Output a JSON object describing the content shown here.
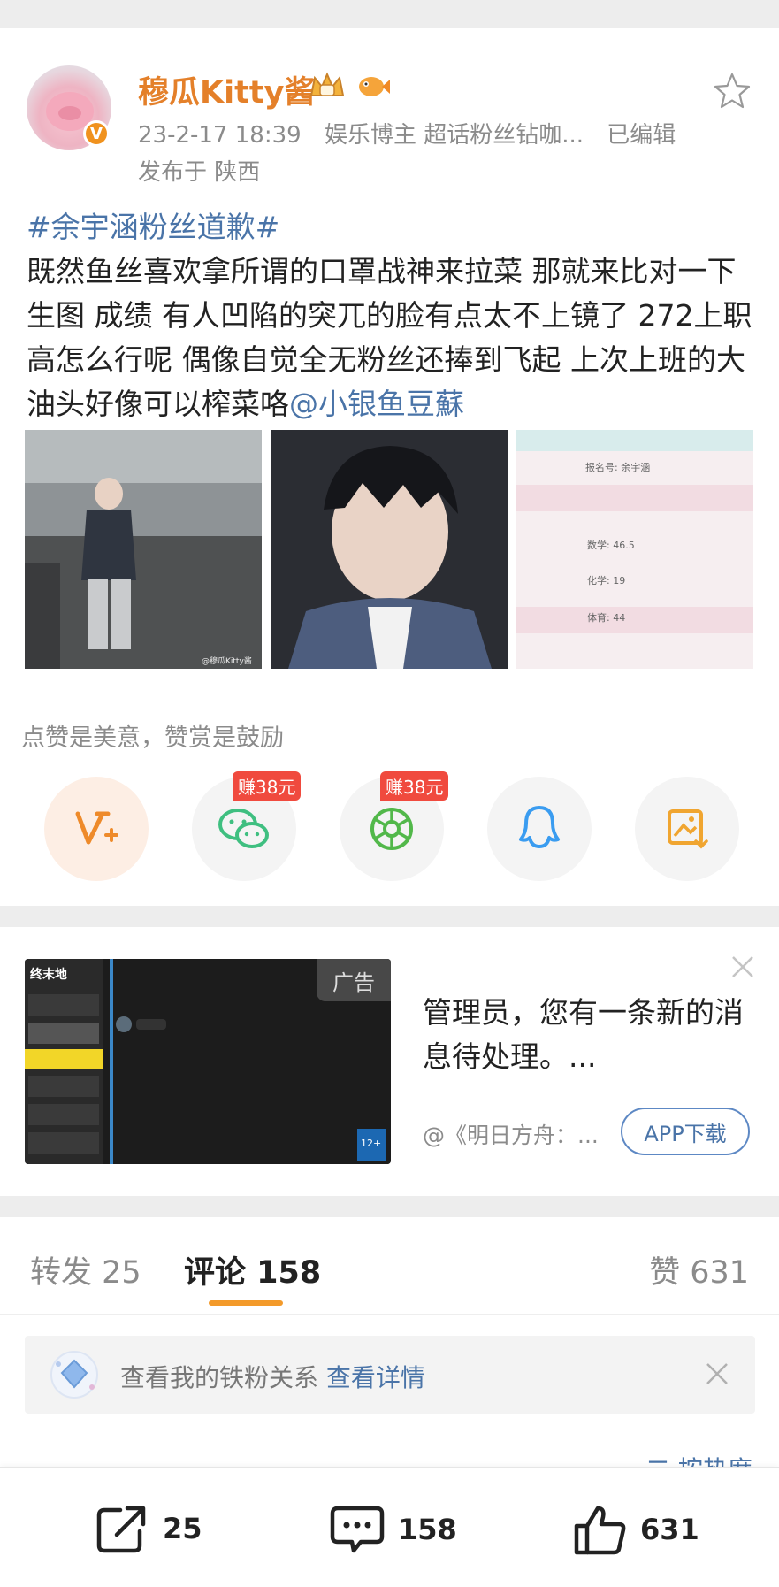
{
  "post": {
    "author": "穆瓜Kitty酱",
    "timestamp": "23-2-17 18:39",
    "author_tag": "娱乐博主 超话粉丝钻咖...",
    "edited": "已编辑",
    "location": "发布于 陕西",
    "topic": "#余宇涵粉丝道歉#",
    "body": "既然鱼丝喜欢拿所谓的口罩战神来拉菜 那就来比对一下生图 成绩 有人凹陷的突兀的脸有点太不上镜了 272上职高怎么行呢 偶像自觉全无粉丝还捧到飞起 上次上班的大油头好像可以榨菜咯",
    "mention": "@小银鱼豆蘇",
    "verified_badge": "V",
    "icons": [
      "crown-badge-icon",
      "fish-badge-icon",
      "star-icon"
    ]
  },
  "images": {
    "watermark": "@穆瓜Kitty酱",
    "score_sheet": {
      "name_row": "报名号: 余宇涵",
      "rows": [
        "数学: 46.5",
        "化学: 19",
        "体育: 44"
      ]
    }
  },
  "reward": {
    "text": "点赞是美意，赞赏是鼓励",
    "earn_badge_1": "赚38元",
    "earn_badge_2": "赚38元",
    "icons": [
      "weibo-reward-icon",
      "wechat-icon",
      "moments-icon",
      "qq-icon",
      "save-image-icon"
    ]
  },
  "ad": {
    "label": "广告",
    "title": "管理员，您有一条新的消息待处理。...",
    "source": "@《明日方舟：...",
    "download": "APP下载",
    "rating": "12+",
    "logo_text": "终末地"
  },
  "tabs": {
    "repost": "转发 25",
    "comment": "评论 158",
    "like": "赞 631"
  },
  "fans": {
    "text": "查看我的铁粉关系",
    "link": "查看详情"
  },
  "sort_peek": "二 按热度",
  "bottom": {
    "repost_count": "25",
    "comment_count": "158",
    "like_count": "631"
  },
  "colors": {
    "accent_orange": "#e4802a",
    "link_blue": "#4a74a8",
    "earn_red": "#f04a3e",
    "tab_underline": "#f39a2a"
  }
}
